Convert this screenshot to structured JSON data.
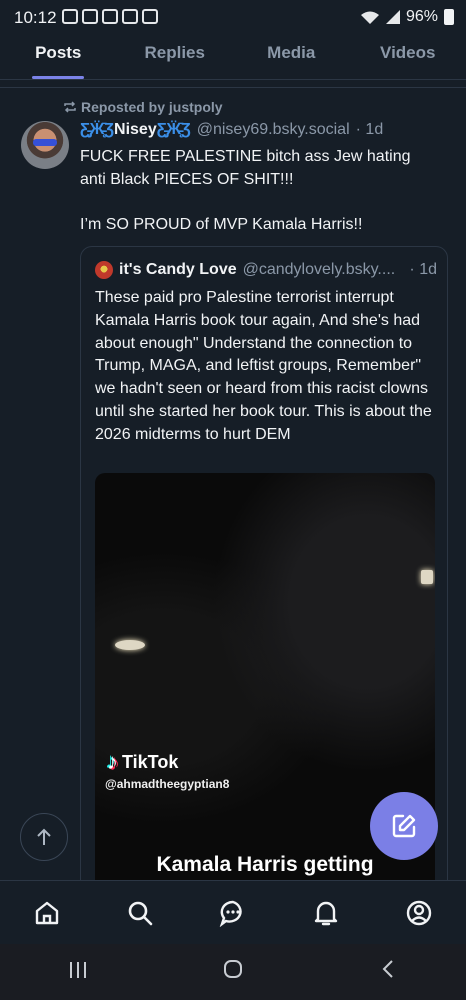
{
  "status_bar": {
    "time": "10:12",
    "battery": "96%"
  },
  "tabs": [
    {
      "label": "Posts",
      "active": true
    },
    {
      "label": "Replies",
      "active": false
    },
    {
      "label": "Media",
      "active": false
    },
    {
      "label": "Videos",
      "active": false
    }
  ],
  "post": {
    "repost_label": "Reposted by justpoly",
    "author_name": "Nisey",
    "author_handle": "@nisey69.bsky.social",
    "time": "· 1d",
    "text": "FUCK FREE PALESTINE bitch ass Jew hating anti Black PIECES OF SHIT!!!\n\nI’m SO PROUD of MVP Kamala Harris!!"
  },
  "quote": {
    "author_name": "it's Candy Love",
    "author_handle": "@candylovely.bsky....",
    "time": "· 1d",
    "text": "These paid pro Palestine terrorist interrupt Kamala Harris book tour again, And she's had about enough\" Understand the connection to Trump, MAGA, and leftist groups, Remember\" we hadn't seen or heard from this racist clowns until she started her book tour. This is about the 2026 midterms to hurt DEM",
    "video": {
      "brand": "TikTok",
      "username": "@ahmadtheegyptian8",
      "caption": "Kamala Harris getting"
    }
  },
  "colors": {
    "background": "#161e27",
    "accent": "#7b83e8",
    "muted": "#8b98a8",
    "compose": "#7b7fe6"
  },
  "nav": [
    "home-icon",
    "search-icon",
    "chat-icon",
    "bell-icon",
    "profile-icon"
  ]
}
